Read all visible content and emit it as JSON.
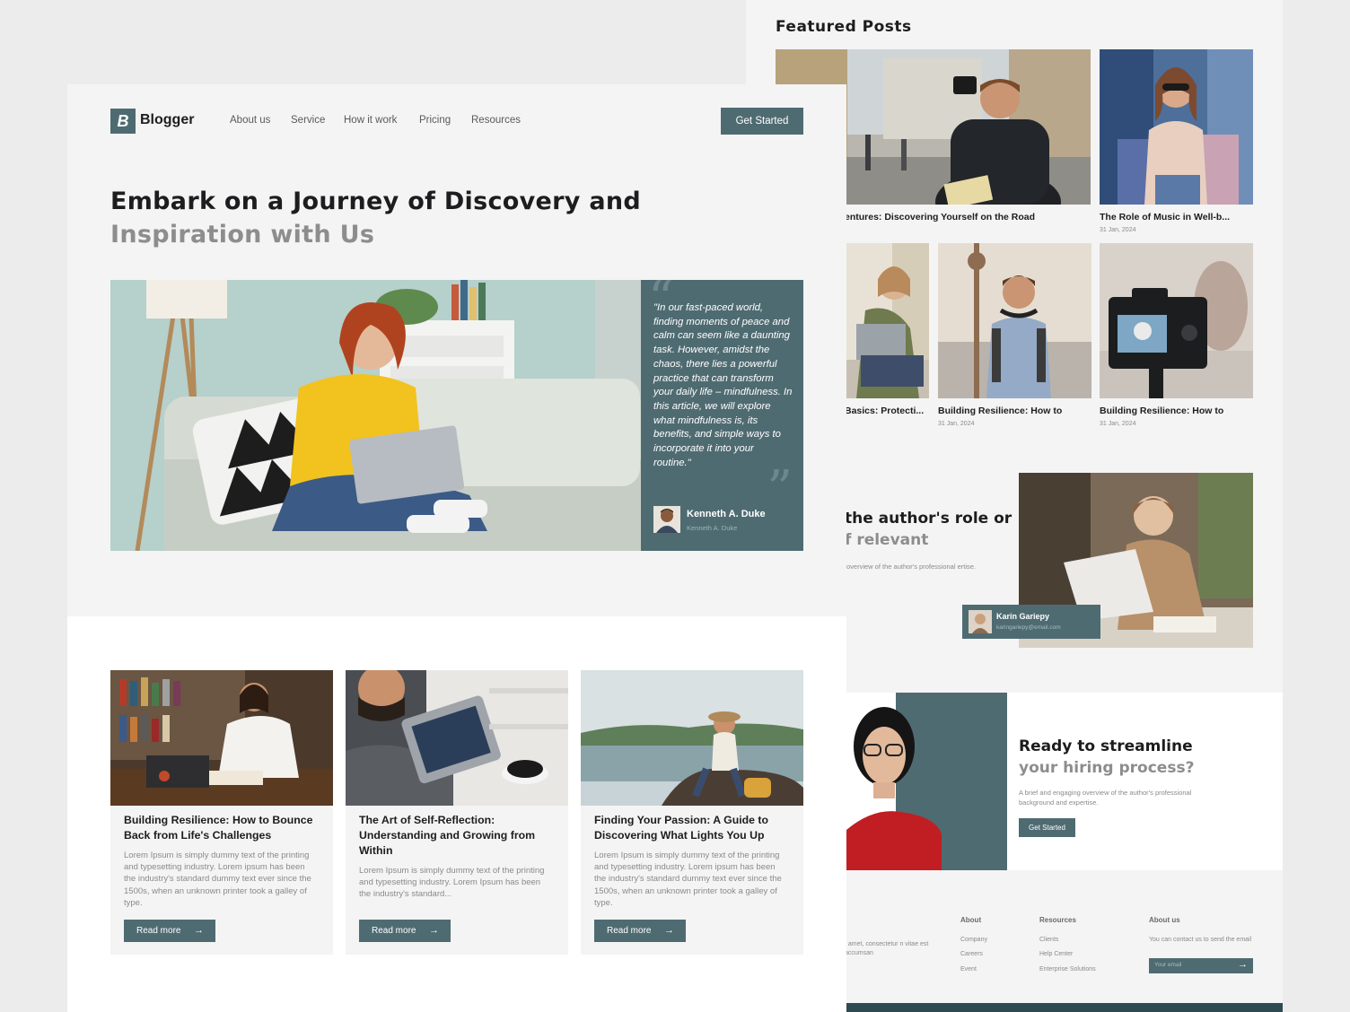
{
  "featured": {
    "title": "Featured Posts",
    "posts": [
      {
        "title": "entures: Discovering Yourself on the Road"
      },
      {
        "title": "The Role of Music in Well-b...",
        "date": "31 Jan, 2024"
      },
      {
        "title": "Basics: Protecti..."
      },
      {
        "title": "Building Resilience: How to",
        "date": "31 Jan, 2024"
      },
      {
        "title": "Building Resilience: How to",
        "date": "31 Jan, 2024"
      }
    ]
  },
  "author": {
    "heading_line1": "the author's role or",
    "heading_line2": "f relevant",
    "description": "overview of the author's professional ertise.",
    "name": "Karin Gariepy",
    "email": "karingariepy@email.com"
  },
  "cta": {
    "title_line1": "Ready to streamline",
    "title_line2": "your hiring process?",
    "description": "A brief and engaging overview of the author's professional background and expertise.",
    "button": "Get Started"
  },
  "footer": {
    "left_text": "t amet, consectetur n vitae est accumsan",
    "col1": {
      "title": "About",
      "links": [
        "Company",
        "Careers",
        "Event"
      ]
    },
    "col2": {
      "title": "Resources",
      "links": [
        "Clients",
        "Help Center",
        "Enterprise Solutions"
      ]
    },
    "col3": {
      "title": "About us",
      "text": "You can contact us to send the email",
      "email_placeholder": "Your email"
    }
  },
  "nav": {
    "brand": "Blogger",
    "logo_letter": "B",
    "items": [
      "About us",
      "Service",
      "How it work",
      "Pricing",
      "Resources"
    ],
    "cta": "Get Started"
  },
  "hero": {
    "title_line1": "Embark on a Journey of Discovery and",
    "title_line2": "Inspiration with Us",
    "quote": "\"In our fast-paced world, finding moments of peace and calm can seem like a daunting task. However, amidst the chaos, there lies a powerful practice that can transform your daily life – mindfulness. In this article, we will explore what mindfulness is, its benefits, and simple ways to incorporate it into your routine.\"",
    "quote_author": "Kenneth A. Duke",
    "quote_author_sub": "Kenneth A. Duke"
  },
  "cards": [
    {
      "title": "Building Resilience: How to Bounce Back from Life's Challenges",
      "body": "Lorem Ipsum is simply dummy text of the printing and typesetting industry. Lorem ipsum has been the industry's standard dummy text ever since the 1500s, when an unknown printer took a galley of type.",
      "button": "Read more"
    },
    {
      "title": "The Art of Self-Reflection: Understanding and Growing from Within",
      "body": "Lorem Ipsum is simply dummy text of the printing and typesetting industry. Lorem Ipsum has been the industry's standard...",
      "button": "Read more"
    },
    {
      "title": "Finding Your Passion: A Guide to Discovering What Lights You Up",
      "body": "Lorem Ipsum is simply dummy text of the printing and typesetting industry. Lorem ipsum has been the industry's standard dummy text ever since the 1500s, when an unknown printer took a galley of type.",
      "button": "Read more"
    }
  ],
  "icons": {
    "arrow": "arrow-right-icon",
    "quote": "quote-icon",
    "logo": "logo-icon"
  },
  "colors": {
    "accent": "#4f6b72",
    "dark_text": "#1d1d1f",
    "muted_text": "#8a8a8a",
    "band": "#f4f4f4"
  }
}
